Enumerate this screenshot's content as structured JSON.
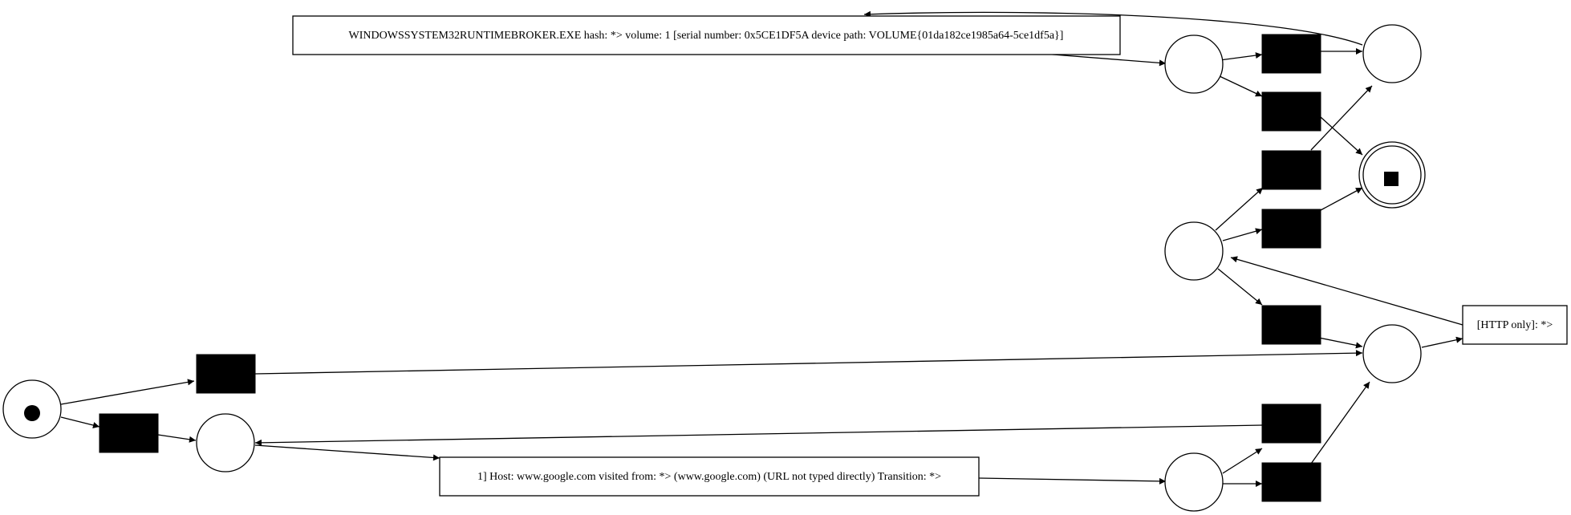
{
  "diagram": {
    "type": "petri-net",
    "labels": {
      "runtime_broker": "WINDOWSSYSTEM32RUNTIMEBROKER.EXE hash: *> volume: 1 [serial number: 0x5CE1DF5A device path: VOLUME{01da182ce1985a64-5ce1df5a}]",
      "http_only": "[HTTP only]: *>",
      "google_host": "1] Host: www.google.com visited from: *> (www.google.com) (URL not typed directly) Transition: *>"
    },
    "colors": {
      "stroke": "#000000",
      "fill_transition": "#000000",
      "fill_place": "#ffffff",
      "background": "#ffffff"
    }
  }
}
